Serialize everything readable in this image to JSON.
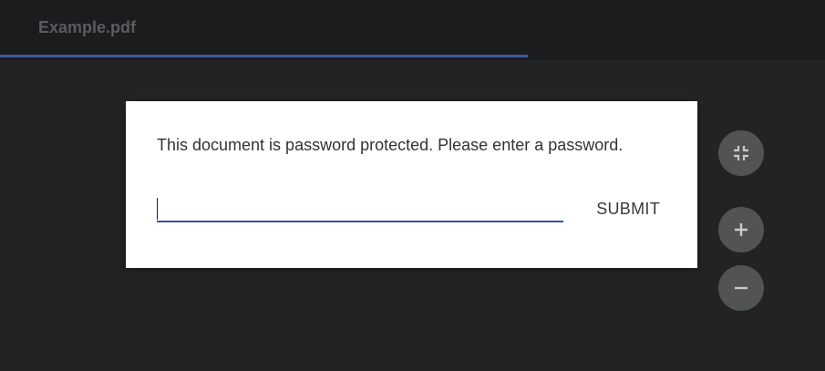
{
  "toolbar": {
    "document_title": "Example.pdf",
    "load_progress": 0.64
  },
  "password_dialog": {
    "message": "This document is password protected. Please enter a password.",
    "input_value": "",
    "submit_label": "SUBMIT"
  },
  "zoom_controls": [
    {
      "icon": "fit-to-page-icon"
    },
    {
      "icon": "plus-icon"
    },
    {
      "icon": "minus-icon"
    }
  ],
  "colors": {
    "background": "#232325",
    "toolbar": "#1b1c1e",
    "accent": "#3b4fa8",
    "fab": "#525355"
  }
}
